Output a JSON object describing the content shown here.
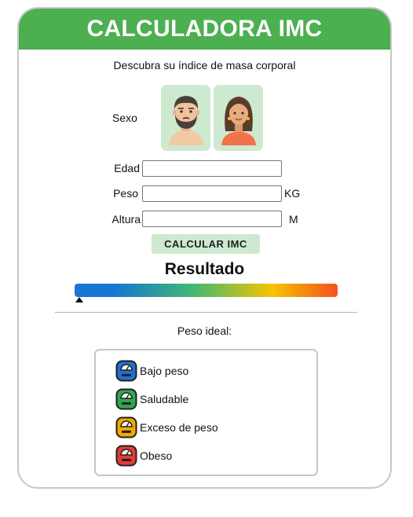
{
  "header": {
    "title": "CALCULADORA IMC"
  },
  "subtitle": "Descubra su índice de masa corporal",
  "sex": {
    "label": "Sexo",
    "options": [
      "male-avatar",
      "female-avatar"
    ]
  },
  "form": {
    "age": {
      "label": "Edad",
      "value": ""
    },
    "weight": {
      "label": "Peso",
      "value": "",
      "unit": "KG"
    },
    "height": {
      "label": "Altura",
      "value": "",
      "unit": "M"
    }
  },
  "calculate_button": "CALCULAR IMC",
  "result": {
    "title": "Resultado",
    "scale_colors": [
      "#1976d2",
      "#42b873",
      "#f5c400",
      "#f4511e"
    ],
    "marker_position_fraction": 0.0
  },
  "ideal_weight_label": "Peso ideal:",
  "legend": [
    {
      "label": "Bajo peso",
      "color": "#1e6fd0",
      "icon": "scale-icon"
    },
    {
      "label": "Saludable",
      "color": "#2fa84f",
      "icon": "scale-icon"
    },
    {
      "label": "Exceso de peso",
      "color": "#f2a900",
      "icon": "scale-icon"
    },
    {
      "label": "Obeso",
      "color": "#e53935",
      "icon": "scale-icon"
    }
  ]
}
